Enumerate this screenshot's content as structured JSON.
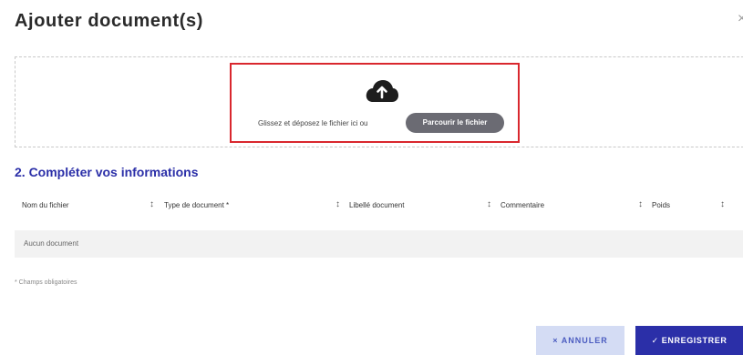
{
  "modal": {
    "title": "Ajouter document(s)",
    "close_glyph": "×"
  },
  "dropzone": {
    "icon": "cloud-upload-icon",
    "instruction": "Glissez et déposez le fichier ici ou",
    "browse_label": "Parcourir le fichier"
  },
  "section": {
    "title": "2. Compléter vos informations"
  },
  "table": {
    "columns": [
      "Nom du fichier",
      "Type de document *",
      "Libellé document",
      "Commentaire",
      "Poids"
    ],
    "sort_glyph": "↕",
    "empty_text": "Aucun document"
  },
  "footnote": "* Champs obligatoires",
  "actions": {
    "cancel_label": "× ANNULER",
    "save_label": "✓ ENREGISTRER"
  },
  "colors": {
    "accent": "#2b2fa8",
    "cancel_bg": "#d4dcf4",
    "highlight": "#d9272e",
    "browse_bg": "#6b6b73"
  }
}
